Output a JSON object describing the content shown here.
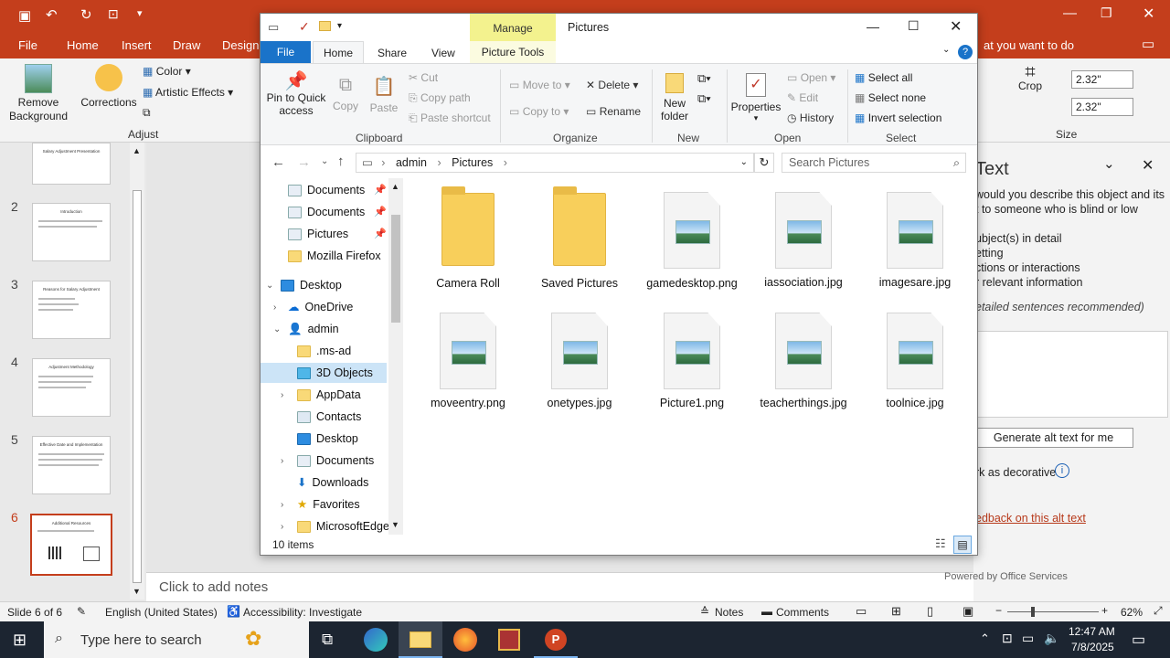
{
  "powerpoint": {
    "tabs": [
      "File",
      "Home",
      "Insert",
      "Draw",
      "Design"
    ],
    "tell_me": "at you want to do",
    "ribbon": {
      "remove_background": "Remove Background",
      "corrections": "Corrections",
      "color": "Color",
      "artistic_effects": "Artistic Effects",
      "adjust_label": "Adjust",
      "crop": "Crop",
      "height_value": "2.32\"",
      "width_value": "2.32\"",
      "size_label": "Size"
    },
    "slides": [
      {
        "num": "",
        "title": "Salary Adjustment Presentation"
      },
      {
        "num": "2",
        "title": "Introduction"
      },
      {
        "num": "3",
        "title": "Reasons for Salary Adjustment"
      },
      {
        "num": "4",
        "title": "Adjustment Methodology"
      },
      {
        "num": "5",
        "title": "Effective Date and Implementation"
      },
      {
        "num": "6",
        "title": "Additional Resources"
      }
    ],
    "notes_placeholder": "Click to add notes",
    "alt_text_pane": {
      "title": "Text",
      "desc_line1": "would you describe this object and its",
      "desc_line2": "t to someone who is blind or low",
      "bullet1": "ubject(s) in detail",
      "bullet2": "etting",
      "bullet3": "ctions or interactions",
      "bullet4": "r relevant information",
      "hint": "etailed sentences recommended)",
      "generate_button": "Generate alt text for me",
      "decorative_label": "rk as decorative",
      "feedback_link": "edback on this alt text",
      "powered_by": "Powered by Office Services"
    },
    "status": {
      "slide": "Slide 6 of 6",
      "language": "English (United States)",
      "accessibility": "Accessibility: Investigate",
      "notes": "Notes",
      "comments": "Comments",
      "zoom": "62%"
    }
  },
  "explorer": {
    "manage_label": "Manage",
    "title": "Pictures",
    "tabs": [
      "File",
      "Home",
      "Share",
      "View",
      "Picture Tools"
    ],
    "ribbon": {
      "pin_quick_access": "Pin to Quick access",
      "copy": "Copy",
      "paste": "Paste",
      "cut": "Cut",
      "copy_path": "Copy path",
      "paste_shortcut": "Paste shortcut",
      "clipboard": "Clipboard",
      "move_to": "Move to",
      "copy_to": "Copy to",
      "delete": "Delete",
      "rename": "Rename",
      "organize": "Organize",
      "new_folder": "New folder",
      "new": "New",
      "properties": "Properties",
      "open": "Open",
      "edit": "Edit",
      "history": "History",
      "open_group": "Open",
      "select_all": "Select all",
      "select_none": "Select none",
      "invert_selection": "Invert selection",
      "select_group": "Select"
    },
    "address": {
      "part1": "admin",
      "part2": "Pictures"
    },
    "search_placeholder": "Search Pictures",
    "nav": [
      {
        "label": "Documents",
        "pinned": true
      },
      {
        "label": "Documents",
        "pinned": true
      },
      {
        "label": "Pictures",
        "pinned": true
      },
      {
        "label": "Mozilla Firefox",
        "pinned": false
      },
      {
        "label": "Desktop"
      },
      {
        "label": "OneDrive"
      },
      {
        "label": "admin"
      },
      {
        "label": ".ms-ad"
      },
      {
        "label": "3D Objects"
      },
      {
        "label": "AppData"
      },
      {
        "label": "Contacts"
      },
      {
        "label": "Desktop"
      },
      {
        "label": "Documents"
      },
      {
        "label": "Downloads"
      },
      {
        "label": "Favorites"
      },
      {
        "label": "MicrosoftEdge"
      }
    ],
    "files": [
      {
        "name": "Camera Roll",
        "type": "folder"
      },
      {
        "name": "Saved Pictures",
        "type": "folder"
      },
      {
        "name": "gamedesktop.png",
        "type": "image"
      },
      {
        "name": "iassociation.jpg",
        "type": "image"
      },
      {
        "name": "imagesare.jpg",
        "type": "image"
      },
      {
        "name": "moveentry.png",
        "type": "image"
      },
      {
        "name": "onetypes.jpg",
        "type": "image"
      },
      {
        "name": "Picture1.png",
        "type": "image"
      },
      {
        "name": "teacherthings.jpg",
        "type": "image"
      },
      {
        "name": "toolnice.jpg",
        "type": "image"
      }
    ],
    "item_count": "10 items"
  },
  "taskbar": {
    "search_placeholder": "Type here to search",
    "time": "12:47 AM",
    "date": "7/8/2025"
  },
  "colors": {
    "pp_accent": "#c43e1c",
    "explorer_accent": "#1a73c9",
    "manage_tab": "#f3f28e"
  }
}
